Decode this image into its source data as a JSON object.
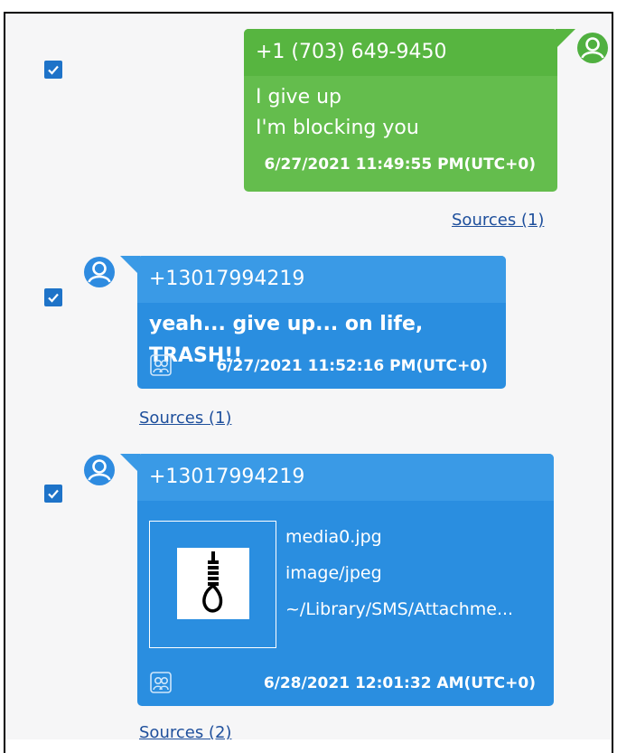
{
  "colors": {
    "outgoing": "#64bd4d",
    "outgoing_header": "#57b540",
    "incoming": "#2a8ee0",
    "incoming_header": "#3a9ae6",
    "checkbox": "#1e73c8",
    "avatar": "#2e8be0",
    "avatar_green": "#50b040",
    "link": "#1e4f9c",
    "panel": "#f6f6f7"
  },
  "messages": [
    {
      "direction": "outgoing",
      "sender": "+1 (703) 649-9450",
      "lines": [
        "I give up",
        "I'm blocking you"
      ],
      "timestamp": "6/27/2021 11:49:55 PM(UTC+0)",
      "sources": "Sources (1)",
      "checked": true
    },
    {
      "direction": "incoming",
      "sender": "+13017994219",
      "lines": [
        "yeah... give up... on life, TRASH!!"
      ],
      "timestamp": "6/27/2021 11:52:16 PM(UTC+0)",
      "sources": "Sources (1)",
      "checked": true
    },
    {
      "direction": "incoming",
      "sender": "+13017994219",
      "attachment": {
        "filename": "media0.jpg",
        "mime": "image/jpeg",
        "path": "~/Library/SMS/Attachme...",
        "icon": "noose-image-icon"
      },
      "timestamp": "6/28/2021 12:01:32 AM(UTC+0)",
      "sources": "Sources (2)",
      "checked": true
    }
  ]
}
